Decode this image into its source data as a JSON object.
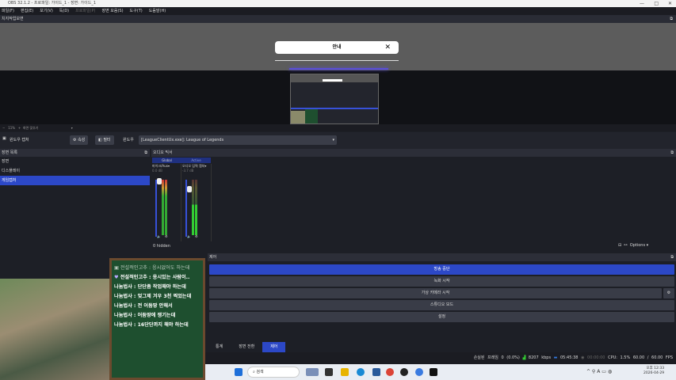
{
  "window": {
    "title": "OBS 32.1.2 - 프로파일: 가이드_1 - 장면: 가이드_1"
  },
  "menu": [
    "파일(F)",
    "편집(E)",
    "보기(V)",
    "독(D)",
    "프로파일(P)",
    "장면 모음(S)",
    "도구(T)",
    "도움말(H)"
  ],
  "preview": {
    "dock_title": "치지작업모면",
    "dialog_title": "안내",
    "zoom": "11%",
    "zoom_label": "화면 맞추기"
  },
  "source_toolbar": {
    "source_name": "윈도우 캡처",
    "properties": "속성",
    "filters": "필터",
    "window_label": "윈도우",
    "window_value": "[LeagueClientUx.exe]: League of Legends"
  },
  "scenes": {
    "title": "장면 목록",
    "items": [
      "장면",
      "디스플레이",
      "게임캡처"
    ]
  },
  "mixer": {
    "title": "오디오 믹서",
    "tabs": [
      "Global",
      "Active"
    ],
    "channels": [
      {
        "name": "마이크/Aux",
        "db": "0.0 dB"
      },
      {
        "name": "오디오 입력 캡처",
        "db": "-3.7 dB"
      }
    ],
    "hidden": "0 hidden",
    "options": "Options"
  },
  "controls": {
    "title": "제어",
    "buttons": [
      "방송 중단",
      "녹화 시작",
      "가상 카메라 시작",
      "스튜디오 모드",
      "설정"
    ]
  },
  "bottom_tabs": [
    "통계",
    "장면 전환",
    "제어"
  ],
  "status": {
    "dropped": "손실된 프레임 0 (0.0%)",
    "bitrate": "8207 kbps",
    "stream_time": "05:45:38",
    "rec_time": "00:00:00",
    "cpu": "CPU: 1.5%",
    "fps": "60.00 / 60.00 FPS"
  },
  "taskbar": {
    "search": "검색",
    "time": "오후 12:33",
    "date": "2026-04-29"
  },
  "chat": [
    {
      "user": "전설적인고추",
      "msg": "응시없어도 하는데"
    },
    {
      "user": "전설적인고추",
      "msg": "응시있는 사람이.."
    },
    {
      "user": "나눔법사",
      "msg": "단단좀 작업해야 하는데"
    },
    {
      "user": "나눔법사",
      "msg": "엊그제 겨우 3천 찍었는데"
    },
    {
      "user": "나눔법사",
      "msg": "전 어둠땅 안해서"
    },
    {
      "user": "나눔법사",
      "msg": "어둠땅에 쟁기는데"
    },
    {
      "user": "나눔법사",
      "msg": "16단단까지 해야 하는데"
    }
  ]
}
